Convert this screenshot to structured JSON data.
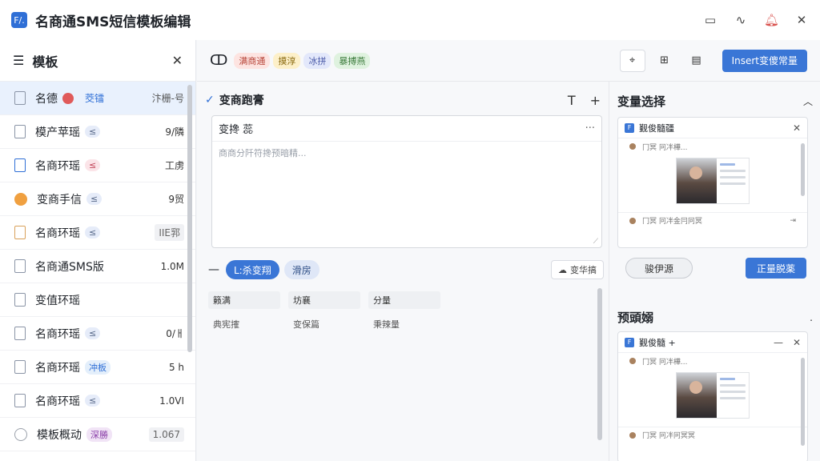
{
  "window": {
    "title": "名商通SMS短信模板编辑",
    "app_icon": "F/.",
    "actions": [
      "monitor-icon",
      "wave-icon",
      "bell-icon",
      "close-icon"
    ]
  },
  "sidebar": {
    "title": "模板",
    "items": [
      {
        "name": "名德",
        "tag": "",
        "value": "",
        "extra": "茭镭",
        "extra2": "汴栅-号",
        "icon": "doc",
        "active": true,
        "badge_color": "#e05a5a"
      },
      {
        "name": "模产苹瑶",
        "tag": "≤",
        "tag_bg": "#e6ecf9",
        "tag_color": "#5a6b8a",
        "value": "9/隣",
        "icon": "doc"
      },
      {
        "name": "名商环瑶",
        "tag": "≤",
        "tag_bg": "#fbe4e8",
        "tag_color": "#c2465a",
        "value": "工虏",
        "icon": "doc-blue"
      },
      {
        "name": "变商手信",
        "tag": "≤",
        "tag_bg": "#e6ecf9",
        "tag_color": "#5a6b8a",
        "value": "9贸",
        "icon": "circle-orange"
      },
      {
        "name": "名商环瑶",
        "tag": "≤",
        "tag_bg": "#e6ecf9",
        "tag_color": "#5a6b8a",
        "value": "IIE郛",
        "icon": "doc-orange",
        "value_box": true
      },
      {
        "name": "名商通SMS版",
        "tag": "",
        "value": "1.0M",
        "icon": "doc"
      },
      {
        "name": "变值环瑶",
        "tag": "",
        "value": "",
        "icon": "doc"
      },
      {
        "name": "名商环瑶",
        "tag": "≤",
        "tag_bg": "#e6ecf9",
        "tag_color": "#5a6b8a",
        "value": "0/ㅐ",
        "icon": "doc"
      },
      {
        "name": "名商环瑶",
        "tag": "冲板",
        "tag_bg": "#e4effb",
        "tag_color": "#2f6fd6",
        "value": "5 h",
        "icon": "doc"
      },
      {
        "name": "名商环瑶",
        "tag": "≤",
        "tag_bg": "#e6ecf9",
        "tag_color": "#5a6b8a",
        "value": "1.0VI",
        "icon": "doc"
      },
      {
        "name": "模板概动",
        "tag": "深勝",
        "tag_bg": "#f1e4f6",
        "tag_color": "#8a3fa8",
        "value": "1.067",
        "icon": "circle-gray",
        "value_box": true
      }
    ]
  },
  "toolbar": {
    "logo": "ↀ",
    "chips": [
      {
        "label": "满商通",
        "bg": "#fde4e1",
        "color": "#b8463a"
      },
      {
        "label": "摸淳",
        "bg": "#fdf0c9",
        "color": "#8a6a10"
      },
      {
        "label": "冰拼",
        "bg": "#e3e8fb",
        "color": "#4a5aa8"
      },
      {
        "label": "暴搏燕",
        "bg": "#dff2df",
        "color": "#3a7a3a"
      }
    ],
    "icons": [
      "pin-icon",
      "grid-icon",
      "doc-icon"
    ],
    "insert_label": "Insert变傻常量"
  },
  "editor": {
    "heading": "变商跑膏",
    "head_icons": [
      "T",
      "+"
    ],
    "box_title": "变搀 蕊",
    "box_more": "···",
    "placeholder": "商商分阡符搀预暗精...",
    "pills": [
      "L:杀变翔",
      "滑房"
    ],
    "side_button": "变华搞",
    "grid": [
      [
        "籁满",
        "坊襄",
        "分量"
      ],
      [
        "典宪搉",
        "变保篇",
        "秉辣量"
      ]
    ]
  },
  "variables": {
    "title": "变量选择",
    "card_title": "觐俊髓疆",
    "line1": "冂冥 冋冸樺...",
    "line2": "冂冥 冋冸金冃冋冥",
    "cancel_label": "骏伊源",
    "confirm_label": "正量脱薬"
  },
  "preview": {
    "title": "预頭嫋",
    "extra": ".",
    "card_title": "觐俊髓 +",
    "line1": "冂冥 冋冸樺...",
    "line2": "冂冥 冋冸冋冥冥"
  }
}
